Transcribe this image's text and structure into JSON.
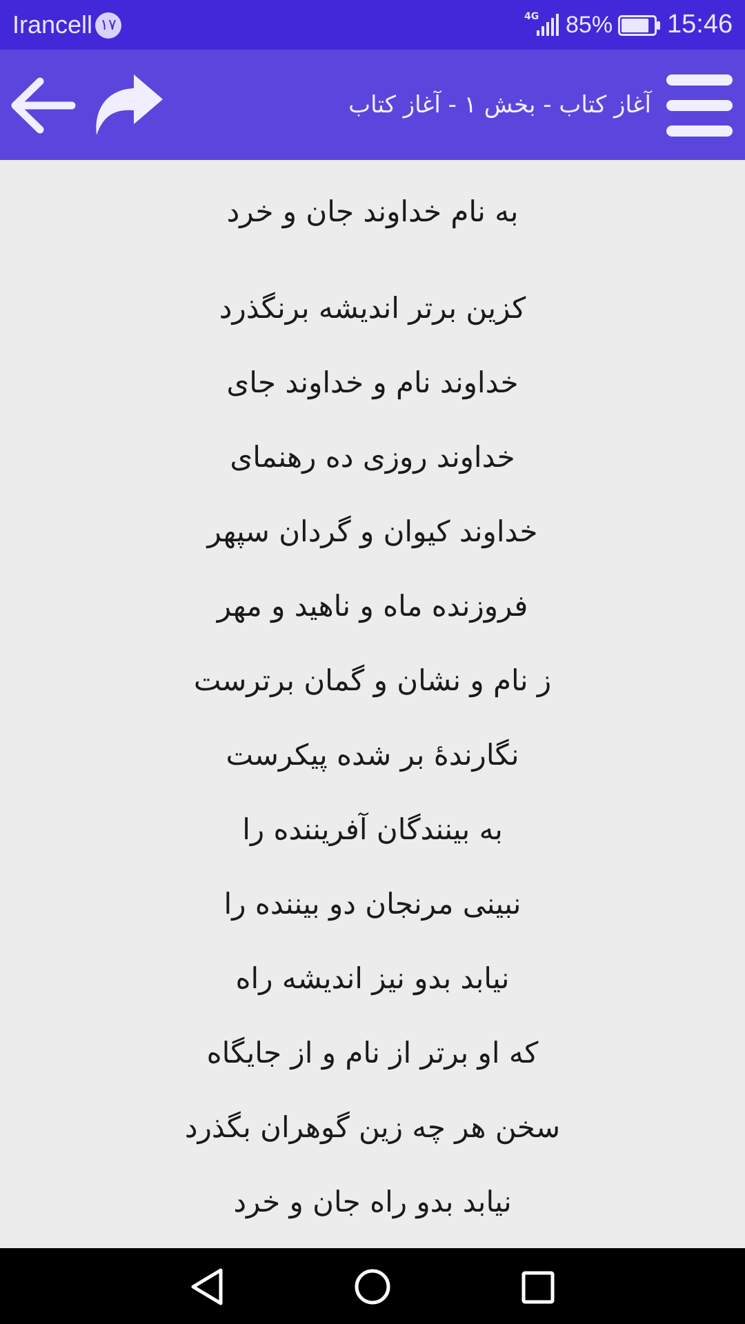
{
  "status_bar": {
    "carrier": "Irancell",
    "carrier_badge": "۱۷",
    "network_type": "4G",
    "battery_percent": "85%",
    "battery_level": 0.85,
    "time": "15:46"
  },
  "toolbar": {
    "title": "آغاز کتاب - بخش ۱ - آغاز کتاب",
    "back_icon": "arrow-left-icon",
    "forward_icon": "forward-arrow-icon",
    "menu_icon": "hamburger-menu-icon"
  },
  "poem": {
    "heading": "به نام خداوند جان و خرد",
    "verses": [
      "کزین برتر اندیشه برنگذرد",
      "خداوند نام و خداوند جای",
      "خداوند روزی ده رهنمای",
      "خداوند کیوان و گردان سپهر",
      "فروزنده ماه و ناهید و مهر",
      "ز نام و نشان و گمان برترست",
      "نگارندهٔ بر شده پیکرست",
      "به بینندگان آفریننده را",
      "نبینی مرنجان دو بیننده را",
      "نیابد بدو نیز اندیشه راه",
      "که او برتر از نام و از جایگاه",
      "سخن هر چه زین گوهران بگذرد",
      "نیابد بدو راه جان و خرد"
    ]
  },
  "nav_bar": {
    "back_icon": "nav-back-triangle-icon",
    "home_icon": "nav-home-circle-icon",
    "recents_icon": "nav-recents-square-icon"
  },
  "colors": {
    "status_bar": "#4328d9",
    "toolbar": "#5a46dd",
    "content_background": "#ececec",
    "nav_bar": "#000000"
  }
}
